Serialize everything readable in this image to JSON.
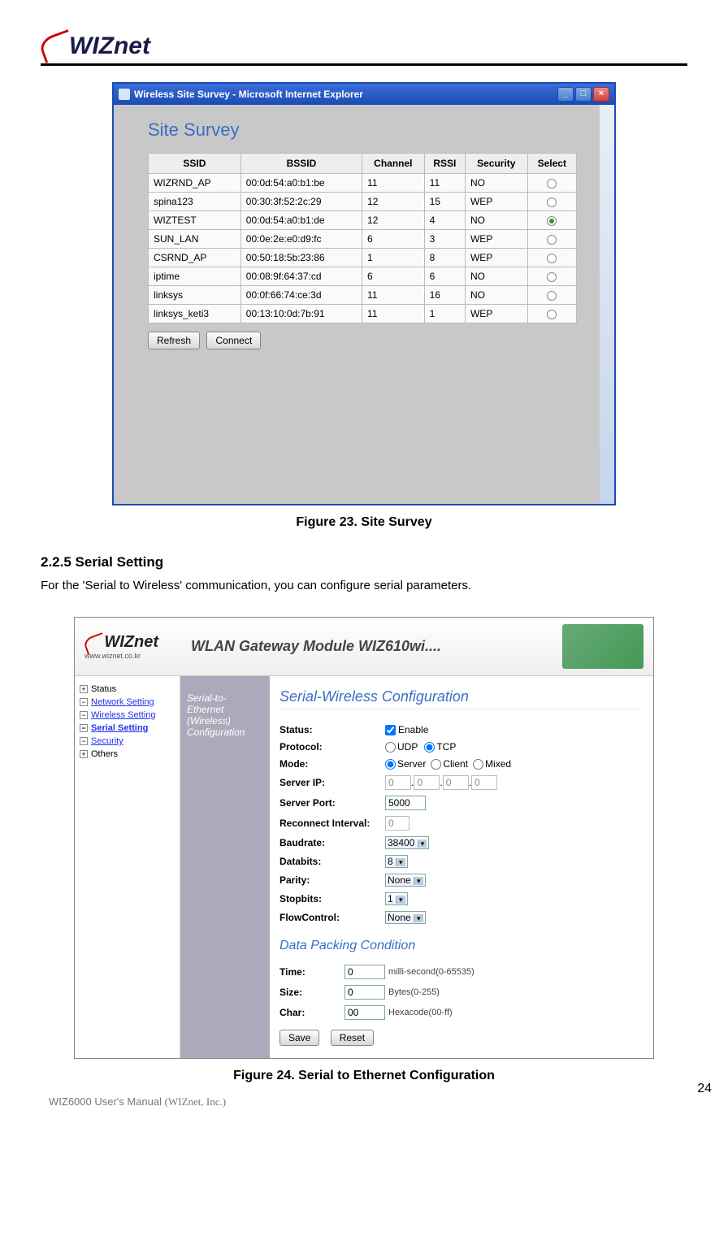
{
  "header_logo": "WIZnet",
  "screenshot1": {
    "window_title": "Wireless Site Survey - Microsoft Internet Explorer",
    "page_heading": "Site Survey",
    "columns": {
      "ssid": "SSID",
      "bssid": "BSSID",
      "channel": "Channel",
      "rssi": "RSSI",
      "security": "Security",
      "select": "Select"
    },
    "rows": [
      {
        "ssid": "WIZRND_AP",
        "bssid": "00:0d:54:a0:b1:be",
        "channel": "11",
        "rssi": "11",
        "security": "NO",
        "selected": false
      },
      {
        "ssid": "spina123",
        "bssid": "00:30:3f:52:2c:29",
        "channel": "12",
        "rssi": "15",
        "security": "WEP",
        "selected": false
      },
      {
        "ssid": "WIZTEST",
        "bssid": "00:0d:54:a0:b1:de",
        "channel": "12",
        "rssi": "4",
        "security": "NO",
        "selected": true
      },
      {
        "ssid": "SUN_LAN",
        "bssid": "00:0e:2e:e0:d9:fc",
        "channel": "6",
        "rssi": "3",
        "security": "WEP",
        "selected": false
      },
      {
        "ssid": "CSRND_AP",
        "bssid": "00:50:18:5b:23:86",
        "channel": "1",
        "rssi": "8",
        "security": "WEP",
        "selected": false
      },
      {
        "ssid": "iptime",
        "bssid": "00:08:9f:64:37:cd",
        "channel": "6",
        "rssi": "6",
        "security": "NO",
        "selected": false
      },
      {
        "ssid": "linksys",
        "bssid": "00:0f:66:74:ce:3d",
        "channel": "11",
        "rssi": "16",
        "security": "NO",
        "selected": false
      },
      {
        "ssid": "linksys_keti3",
        "bssid": "00:13:10:0d:7b:91",
        "channel": "11",
        "rssi": "1",
        "security": "WEP",
        "selected": false
      }
    ],
    "refresh_btn": "Refresh",
    "connect_btn": "Connect"
  },
  "caption1": "Figure 23. Site Survey",
  "section_heading": "2.2.5 Serial Setting",
  "section_body": "For the 'Serial to Wireless' communication, you can configure serial parameters.",
  "screenshot2": {
    "logo": "WIZnet",
    "url": "www.wiznet.co.kr",
    "banner": "WLAN Gateway Module WIZ610wi....",
    "nav": [
      {
        "icon": "+",
        "label": "Status",
        "link": false
      },
      {
        "icon": "−",
        "label": "Network Setting",
        "link": true
      },
      {
        "icon": "−",
        "label": "Wireless Setting",
        "link": true
      },
      {
        "icon": "−",
        "label": "Serial Setting",
        "link": true,
        "bold": true
      },
      {
        "icon": "−",
        "label": "Security",
        "link": true
      },
      {
        "icon": "+",
        "label": "Others",
        "link": false
      }
    ],
    "mid_title": "Serial-to-Ethernet (Wireless) Configuration",
    "main_heading": "Serial-Wireless Configuration",
    "fields": {
      "status": {
        "label": "Status:",
        "value": "Enable"
      },
      "protocol": {
        "label": "Protocol:",
        "opt1": "UDP",
        "opt2": "TCP"
      },
      "mode": {
        "label": "Mode:",
        "opt1": "Server",
        "opt2": "Client",
        "opt3": "Mixed"
      },
      "server_ip": {
        "label": "Server IP:",
        "v": "0"
      },
      "server_port": {
        "label": "Server Port:",
        "v": "5000"
      },
      "reconnect": {
        "label": "Reconnect Interval:",
        "v": "0"
      },
      "baudrate": {
        "label": "Baudrate:",
        "v": "38400"
      },
      "databits": {
        "label": "Databits:",
        "v": "8"
      },
      "parity": {
        "label": "Parity:",
        "v": "None"
      },
      "stopbits": {
        "label": "Stopbits:",
        "v": "1"
      },
      "flow": {
        "label": "FlowControl:",
        "v": "None"
      }
    },
    "packing_heading": "Data Packing Condition",
    "packing": {
      "time": {
        "label": "Time:",
        "v": "0",
        "hint": "milli-second(0-65535)"
      },
      "size": {
        "label": "Size:",
        "v": "0",
        "hint": "Bytes(0-255)"
      },
      "char": {
        "label": "Char:",
        "v": "00",
        "hint": "Hexacode(00-ff)"
      }
    },
    "save": "Save",
    "reset": "Reset"
  },
  "caption2": "Figure 24. Serial to Ethernet Configuration",
  "footer": {
    "manual": "WIZ6000 User's Manual",
    "company": "(WIZnet, Inc.)",
    "page": "24"
  }
}
